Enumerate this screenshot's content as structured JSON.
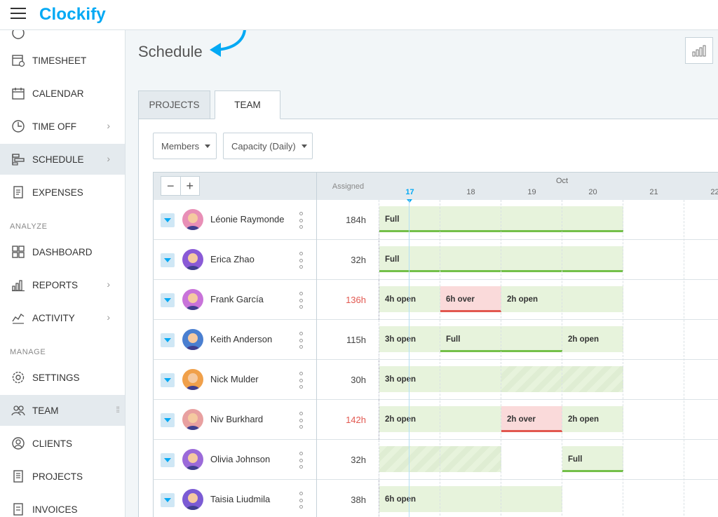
{
  "app": {
    "logo": "Clockify"
  },
  "sidebar": {
    "items": [
      {
        "label": "TIMESHEET",
        "icon": "timesheet-icon"
      },
      {
        "label": "CALENDAR",
        "icon": "calendar-icon"
      },
      {
        "label": "TIME OFF",
        "icon": "time-off-icon"
      },
      {
        "label": "SCHEDULE",
        "icon": "schedule-icon"
      },
      {
        "label": "EXPENSES",
        "icon": "expenses-icon"
      },
      {
        "label": "DASHBOARD",
        "icon": "dashboard-icon"
      },
      {
        "label": "REPORTS",
        "icon": "reports-icon"
      },
      {
        "label": "ACTIVITY",
        "icon": "activity-icon"
      },
      {
        "label": "SETTINGS",
        "icon": "settings-icon"
      },
      {
        "label": "TEAM",
        "icon": "team-icon"
      },
      {
        "label": "CLIENTS",
        "icon": "clients-icon"
      },
      {
        "label": "PROJECTS",
        "icon": "projects-icon"
      },
      {
        "label": "INVOICES",
        "icon": "invoices-icon"
      }
    ],
    "sections": {
      "analyze": "ANALYZE",
      "manage": "MANAGE"
    },
    "active": "SCHEDULE"
  },
  "page": {
    "title": "Schedule"
  },
  "tabs": [
    {
      "label": "PROJECTS"
    },
    {
      "label": "TEAM"
    }
  ],
  "active_tab": "TEAM",
  "filters": {
    "members": "Members",
    "capacity": "Capacity (Daily)"
  },
  "grid": {
    "assigned_label": "Assigned",
    "month": "Oct",
    "days": [
      "17",
      "18",
      "19",
      "20",
      "21",
      "22"
    ],
    "today": "17",
    "rows": [
      {
        "name": "Léonie Raymonde",
        "hours": "184h",
        "over": false,
        "cells": [
          {
            "label": "Full",
            "span": 4,
            "start": 0,
            "type": "g",
            "line": "lg"
          }
        ]
      },
      {
        "name": "Erica Zhao",
        "hours": "32h",
        "over": false,
        "cells": [
          {
            "label": "Full",
            "span": 4,
            "start": 0,
            "type": "g",
            "line": "lg"
          }
        ]
      },
      {
        "name": "Frank García",
        "hours": "136h",
        "over": true,
        "cells": [
          {
            "label": "4h open",
            "span": 1,
            "start": 0,
            "type": "g",
            "line": ""
          },
          {
            "label": "6h over",
            "span": 1,
            "start": 1,
            "type": "r",
            "line": "lr"
          },
          {
            "label": "2h open",
            "span": 2,
            "start": 2,
            "type": "g",
            "line": ""
          }
        ]
      },
      {
        "name": "Keith Anderson",
        "hours": "115h",
        "over": false,
        "cells": [
          {
            "label": "3h open",
            "span": 1,
            "start": 0,
            "type": "g",
            "line": ""
          },
          {
            "label": "Full",
            "span": 2,
            "start": 1,
            "type": "g",
            "line": "lg"
          },
          {
            "label": "2h open",
            "span": 1,
            "start": 3,
            "type": "g",
            "line": ""
          }
        ]
      },
      {
        "name": "Nick Mulder",
        "hours": "30h",
        "over": false,
        "cells": [
          {
            "label": "3h open",
            "span": 2,
            "start": 0,
            "type": "g",
            "line": ""
          },
          {
            "label": "",
            "span": 2,
            "start": 2,
            "type": "h",
            "line": ""
          }
        ]
      },
      {
        "name": "Niv Burkhard",
        "hours": "142h",
        "over": true,
        "cells": [
          {
            "label": "2h open",
            "span": 2,
            "start": 0,
            "type": "g",
            "line": ""
          },
          {
            "label": "2h over",
            "span": 1,
            "start": 2,
            "type": "r",
            "line": "lr"
          },
          {
            "label": "2h open",
            "span": 1,
            "start": 3,
            "type": "g",
            "line": ""
          }
        ]
      },
      {
        "name": "Olivia Johnson",
        "hours": "32h",
        "over": false,
        "cells": [
          {
            "label": "",
            "span": 2,
            "start": 0,
            "type": "h",
            "line": ""
          },
          {
            "label": "Full",
            "span": 1,
            "start": 3,
            "type": "g",
            "line": "lg"
          }
        ]
      },
      {
        "name": "Taisia Liudmila",
        "hours": "38h",
        "over": false,
        "cells": [
          {
            "label": "6h open",
            "span": 3,
            "start": 0,
            "type": "g",
            "line": ""
          }
        ]
      }
    ]
  },
  "colors": {
    "accent": "#03a9f4",
    "open": "#e7f3dc",
    "over": "#fadada",
    "full_line": "#74c04a",
    "over_line": "#e25850"
  }
}
